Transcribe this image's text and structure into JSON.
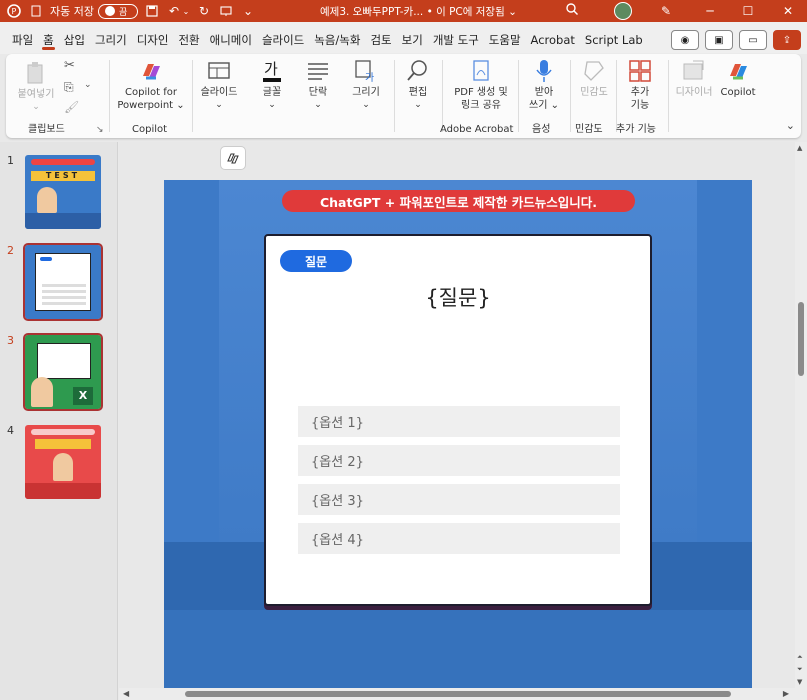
{
  "titlebar": {
    "autosave_label": "자동 저장",
    "autosave_state": "끔",
    "doc_title": "예제3. 오빠두PPT-카...  •  이 PC에 저장됨 ⌄"
  },
  "tabs": [
    "파일",
    "홈",
    "삽입",
    "그리기",
    "디자인",
    "전환",
    "애니메이",
    "슬라이드",
    "녹음/녹화",
    "검토",
    "보기",
    "개발 도구",
    "도움말",
    "Acrobat",
    "Script Lab"
  ],
  "active_tab": "홈",
  "ribbon": {
    "paste": "붙여넣기",
    "clipboard_group": "클립보드",
    "copilot_btn_line1": "Copilot for",
    "copilot_btn_line2": "Powerpoint ⌄",
    "copilot_group": "Copilot",
    "slides": "슬라이드",
    "font": "글꼴",
    "paragraph": "단락",
    "drawing": "그리기",
    "editing": "편집",
    "pdf_line1": "PDF 생성 및",
    "pdf_line2": "링크 공유",
    "acrobat_group": "Adobe Acrobat",
    "dictate_line1": "받아",
    "dictate_line2": "쓰기 ⌄",
    "voice_group": "음성",
    "sensitivity": "민감도",
    "sensitivity_group": "민감도",
    "addins_line1": "추가",
    "addins_line2": "기능",
    "addins_group": "추가 기능",
    "designer": "디자이너",
    "copilot": "Copilot"
  },
  "thumbnails": [
    {
      "num": "1",
      "test_text": "TEST"
    },
    {
      "num": "2"
    },
    {
      "num": "3"
    },
    {
      "num": "4"
    }
  ],
  "slide": {
    "banner": "ChatGPT + 파워포인트로 제작한 카드뉴스입니다.",
    "badge": "질문",
    "question": "{질문}",
    "options": [
      "{옵션 1}",
      "{옵션 2}",
      "{옵션 3}",
      "{옵션 4}"
    ]
  },
  "colors": {
    "accent": "#c43e1c",
    "slide_bg": "#3d7ac7",
    "banner": "#e03a3a",
    "badge": "#1f6ae0"
  }
}
